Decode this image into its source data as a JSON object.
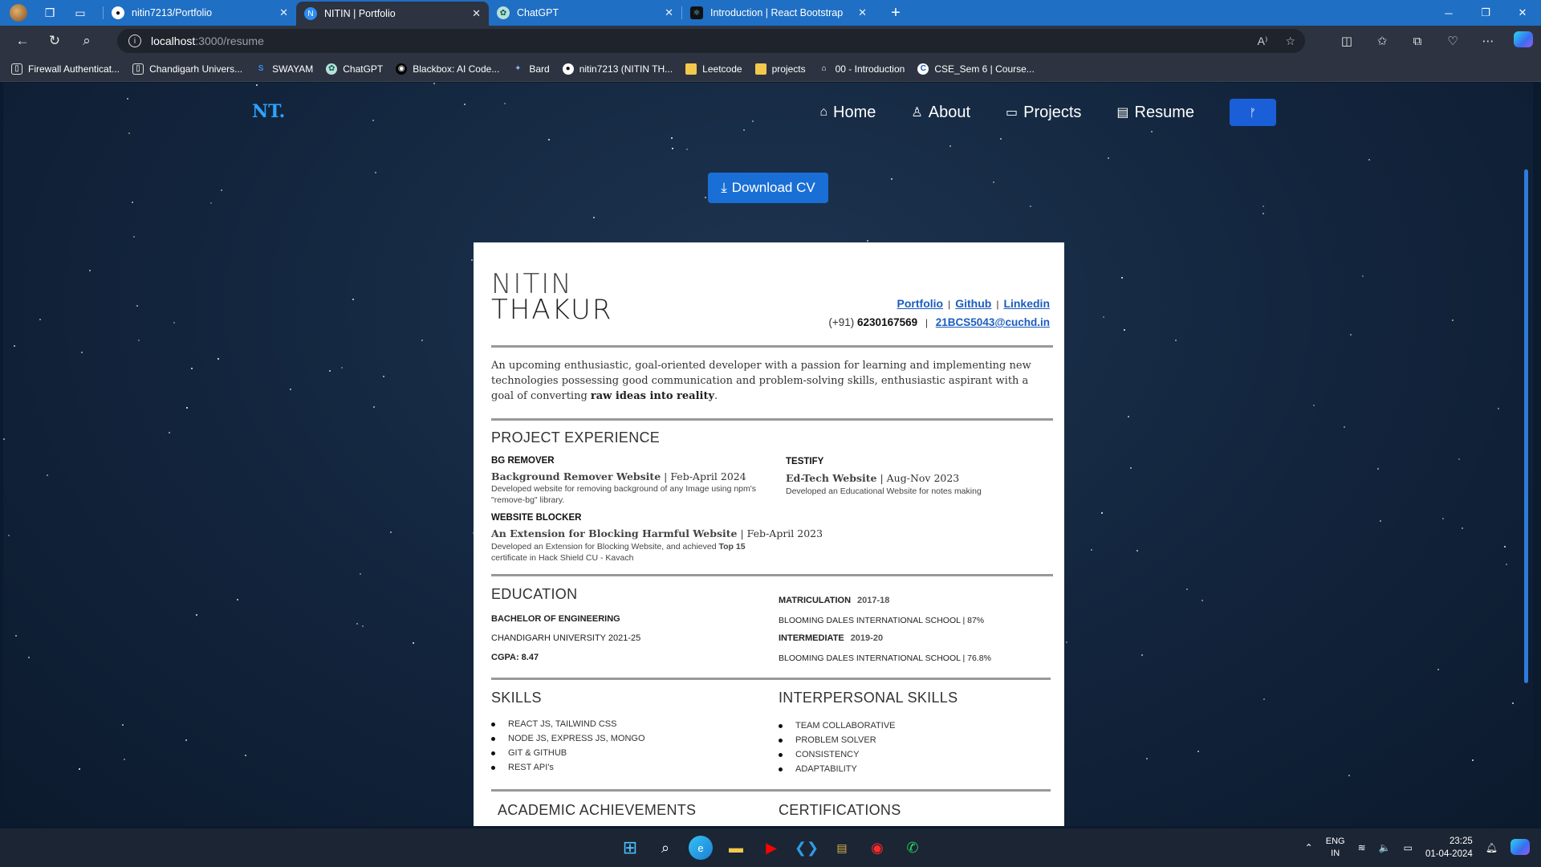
{
  "browser": {
    "tabs": [
      {
        "title": "nitin7213/Portfolio",
        "icon": "github-icon"
      },
      {
        "title": "NITIN | Portfolio",
        "icon": "react-icon",
        "active": true
      },
      {
        "title": "ChatGPT",
        "icon": "chatgpt-icon"
      },
      {
        "title": "Introduction | React Bootstrap",
        "icon": "react-bootstrap-icon"
      }
    ],
    "url_host": "localhost",
    "url_path": ":3000/resume",
    "bookmarks": [
      "Firewall Authenticat...",
      "Chandigarh Univers...",
      "SWAYAM",
      "ChatGPT",
      "Blackbox: AI Code...",
      "Bard",
      "nitin7213 (NITIN TH...",
      "Leetcode",
      "projects",
      "00 - Introduction",
      "CSE_Sem 6 | Course..."
    ]
  },
  "site": {
    "logo": "NT.",
    "menu": [
      "Home",
      "About",
      "Projects",
      "Resume"
    ],
    "fork_button": "ᚠ",
    "download_button": "Download CV"
  },
  "resume": {
    "first_name": "NITIN",
    "last_name": "THAKUR",
    "links": [
      "Portfolio",
      "Github",
      "Linkedin"
    ],
    "phone_prefix": "(+91)",
    "phone": "6230167569",
    "email": "21BCS5043@cuchd.in",
    "summary_text": "An upcoming enthusiastic, goal-oriented developer with a passion for learning and implementing new technologies possessing good communication and problem-solving skills, enthusiastic aspirant with a goal of converting ",
    "summary_bold": "raw ideas into reality",
    "summary_end": ".",
    "project_title": "PROJECT EXPERIENCE",
    "projects": [
      {
        "name": "BG REMOVER",
        "sub": "Background Remover Website",
        "date": " | Feb-April 2024",
        "desc": "Developed website for removing background of any Image using npm's \"remove-bg\" library."
      },
      {
        "name": "TESTIFY",
        "sub": "Ed-Tech Website",
        "date": " | Aug-Nov 2023",
        "desc": "Developed an Educational Website for notes making"
      },
      {
        "name": "WEBSITE BLOCKER",
        "sub": "An Extension for Blocking Harmful Website",
        "date": " | Feb-April 2023",
        "desc_a": "Developed an Extension for Blocking Website, and achieved ",
        "desc_bold": "Top 15",
        "desc_b": " certificate in Hack Shield CU - Kavach"
      }
    ],
    "education_title": "EDUCATION",
    "degree": "BACHELOR OF ENGINEERING",
    "university": "CHANDIGARH UNIVERSITY 2021-25",
    "cgpa": "CGPA: 8.47",
    "matric_label": "MATRICULATION",
    "matric_year": "2017-18",
    "matric_school": "BLOOMING DALES INTERNATIONAL SCHOOL | 87%",
    "inter_label": "INTERMEDIATE",
    "inter_year": "2019-20",
    "inter_school": "BLOOMING DALES INTERNATIONAL SCHOOL | 76.8%",
    "skills_title": "SKILLS",
    "skills": [
      "REACT JS, TAILWIND CSS",
      "NODE JS, EXPRESS JS, MONGO",
      "GIT & GITHUB",
      "REST API's"
    ],
    "interpersonal_title": "INTERPERSONAL SKILLS",
    "interpersonal": [
      "TEAM COLLABORATIVE",
      "PROBLEM SOLVER",
      "CONSISTENCY",
      "ADAPTABILITY"
    ],
    "achievements_title": "ACADEMIC ACHIEVEMENTS",
    "certifications_title": "CERTIFICATIONS"
  },
  "taskbar": {
    "lang_top": "ENG",
    "lang_bottom": "IN",
    "time": "23:25",
    "date": "01-04-2024"
  },
  "colors": {
    "tab_bar": "#1f6fc5",
    "accent_button": "#1a6fd6",
    "logo": "#2ea3ff",
    "link": "#1b5dbf"
  }
}
